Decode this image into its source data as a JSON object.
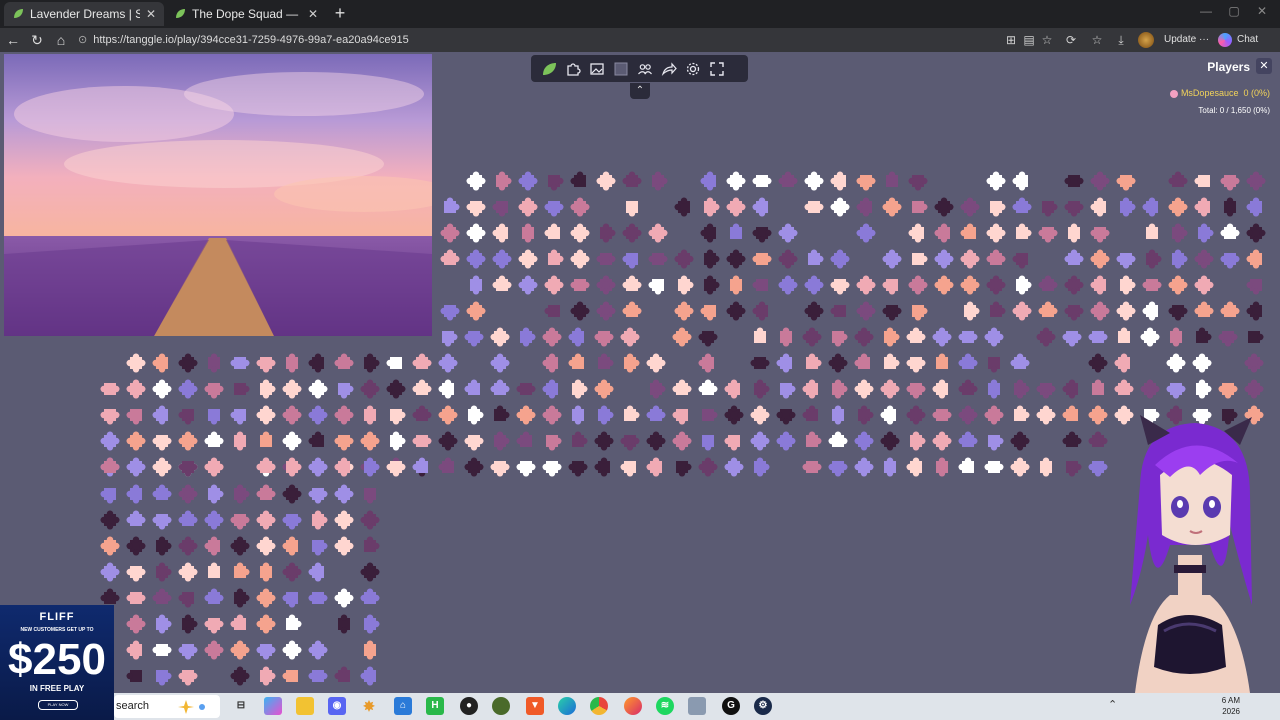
{
  "browser": {
    "tabs": [
      {
        "label": "Lavender Dreams | Sky Jigsaw",
        "active": true
      },
      {
        "label": "The Dope Squad — Puzzles",
        "active": false
      }
    ],
    "url": "https://tanggle.io/play/394cce31-7259-4976-99a7-ea20a94ce915",
    "update_label": "Update",
    "update_more": "···",
    "chat_label": "Chat",
    "new_tab": "+",
    "tab_close": "✕"
  },
  "puzzle": {
    "players_title": "Players",
    "player_name": "MsDopesauce",
    "player_score": "0 (0%)",
    "total_label": "Total: 0 / 1,650 (0%)",
    "colors": {
      "board": "#5b5b73",
      "toolbar": "#2b2b3a",
      "piece_palette": [
        "#f5a38e",
        "#f0aab4",
        "#ffffff",
        "#8a7ad8",
        "#9f8fe6",
        "#7b4a7e",
        "#3a1f3a",
        "#c97a9a",
        "#ffd6d0",
        "#6a3c6a"
      ]
    },
    "toolbar_icons": [
      "leaf-logo-icon",
      "puzzle-piece-icon",
      "image-icon",
      "background-color-icon",
      "players-icon",
      "share-icon",
      "settings-icon",
      "fullscreen-icon"
    ]
  },
  "ad": {
    "brand": "FLIFF",
    "line": "NEW CUSTOMERS GET UP TO",
    "amount": "$250",
    "sub": "IN FREE PLAY",
    "cta": "PLAY NOW"
  },
  "taskbar": {
    "search_label": "search",
    "clock_time": "6 AM",
    "clock_date": "2026"
  }
}
